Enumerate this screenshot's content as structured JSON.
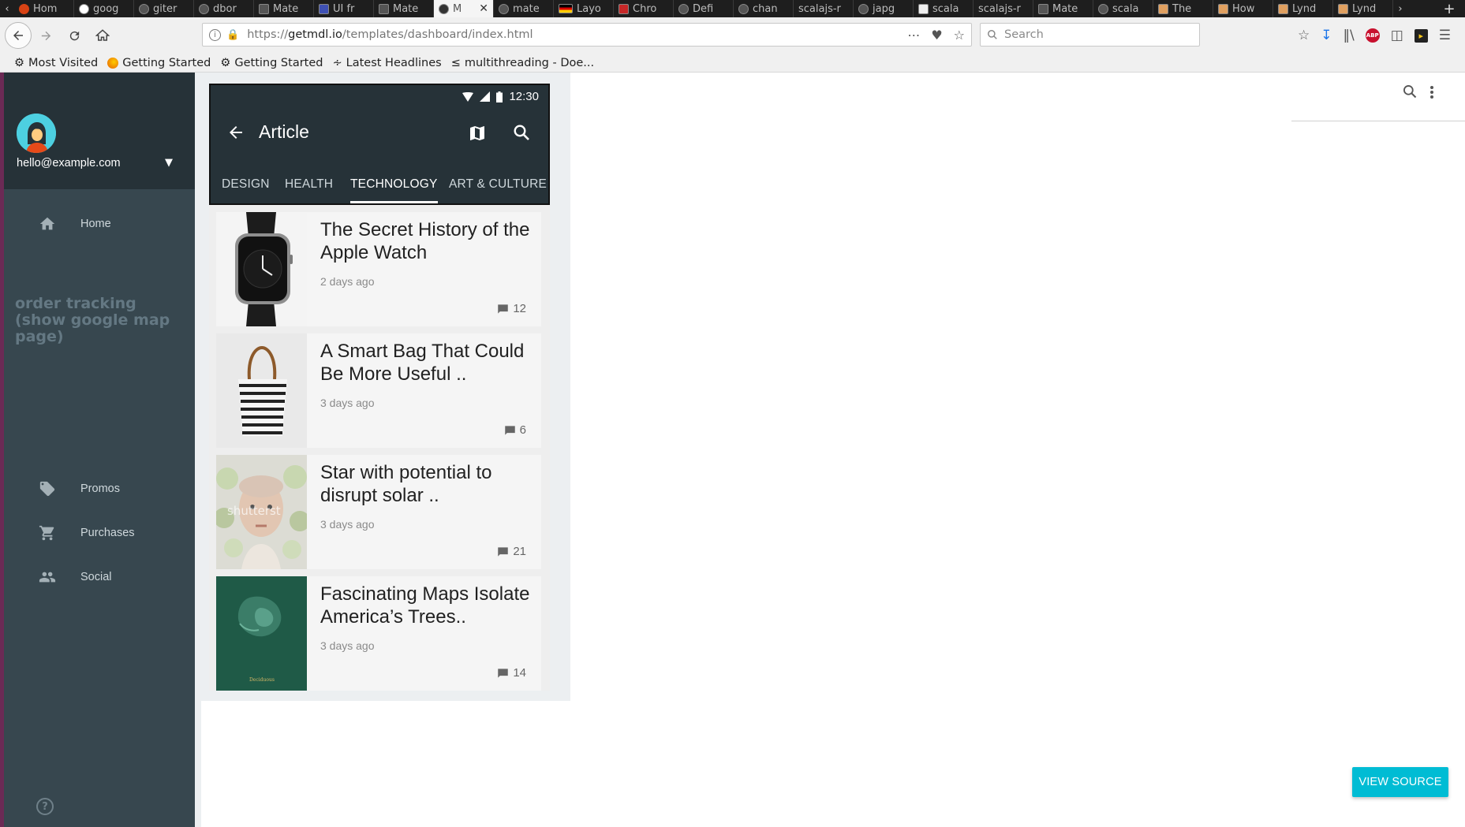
{
  "browser": {
    "tabs": [
      {
        "label": "Hom",
        "active": false
      },
      {
        "label": "goog",
        "active": false
      },
      {
        "label": "giter",
        "active": false
      },
      {
        "label": "dbor",
        "active": false
      },
      {
        "label": "Mate",
        "active": false
      },
      {
        "label": "UI fr",
        "active": false
      },
      {
        "label": "Mate",
        "active": false
      },
      {
        "label": "M",
        "active": true
      },
      {
        "label": "mate",
        "active": false
      },
      {
        "label": "Layo",
        "active": false
      },
      {
        "label": "Chro",
        "active": false
      },
      {
        "label": "Defi",
        "active": false
      },
      {
        "label": "chan",
        "active": false
      },
      {
        "label": "scalajs-r",
        "active": false
      },
      {
        "label": "japg",
        "active": false
      },
      {
        "label": "scala",
        "active": false
      },
      {
        "label": "scalajs-r",
        "active": false
      },
      {
        "label": "Mate",
        "active": false
      },
      {
        "label": "scala",
        "active": false
      },
      {
        "label": "The",
        "active": false
      },
      {
        "label": "How",
        "active": false
      },
      {
        "label": "Lynd",
        "active": false
      },
      {
        "label": "Lynd",
        "active": false
      }
    ],
    "url": {
      "scheme": "https://",
      "host": "getmdl.io",
      "path": "/templates/dashboard/index.html"
    },
    "search_placeholder": "Search",
    "bookmarks": [
      {
        "label": "Most Visited",
        "icon": "gear-icon"
      },
      {
        "label": "Getting Started",
        "icon": "firefox-icon"
      },
      {
        "label": "Getting Started",
        "icon": "gear-icon"
      },
      {
        "label": "Latest Headlines",
        "icon": "rss-icon"
      },
      {
        "label": "multithreading - Doe...",
        "icon": "stack-icon"
      }
    ]
  },
  "drawer": {
    "email": "hello@example.com",
    "items": [
      {
        "label": "Home",
        "icon": "home-icon"
      },
      {
        "label": "Promos",
        "icon": "tag-icon"
      },
      {
        "label": "Purchases",
        "icon": "cart-icon"
      },
      {
        "label": "Social",
        "icon": "people-icon"
      }
    ],
    "overlay_text": "order tracking (show google map page)"
  },
  "phone": {
    "time": "12:30",
    "title": "Article",
    "tabs": [
      "DESIGN",
      "HEALTH",
      "TECHNOLOGY",
      "ART & CULTURE"
    ],
    "active_tab": "TECHNOLOGY",
    "articles": [
      {
        "title": "The Secret History of the Apple Watch",
        "time": "2 days ago",
        "comments": "12"
      },
      {
        "title": "A Smart Bag That Could Be More Useful ..",
        "time": "3 days ago",
        "comments": "6"
      },
      {
        "title": "Star with potential to disrupt solar ..",
        "time": "3 days ago",
        "comments": "21"
      },
      {
        "title": "Fascinating Maps Isolate America’s Trees..",
        "time": "3 days ago",
        "comments": "14"
      }
    ],
    "watermark": "shutterst",
    "book_caption": "Deciduous"
  },
  "view_source_label": "VIEW SOURCE",
  "colors": {
    "drawer_bg": "#37474f",
    "drawer_header_bg": "#263238",
    "appbar_bg": "#263238",
    "accent": "#00bcd4"
  }
}
